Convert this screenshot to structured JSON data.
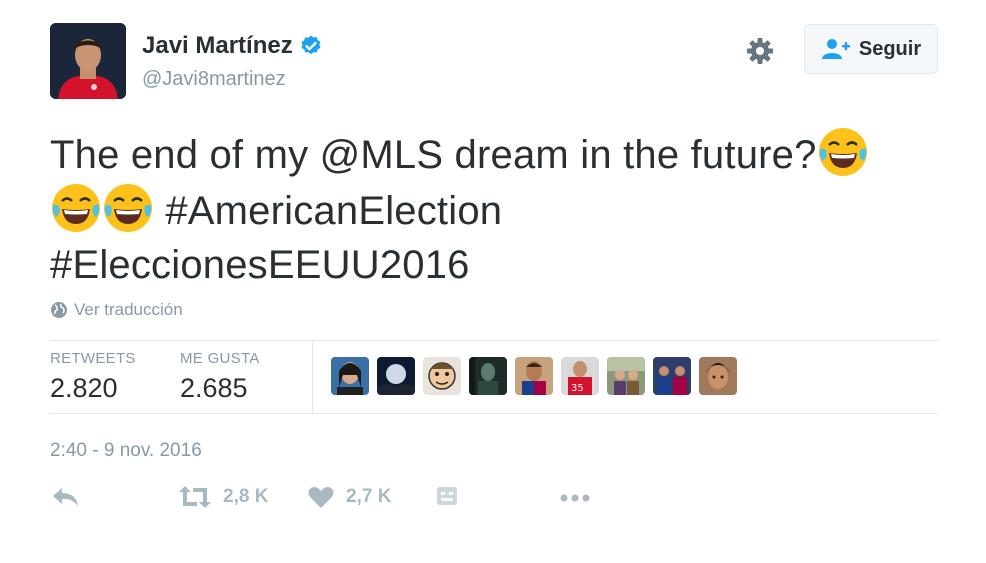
{
  "user": {
    "name": "Javi Martínez",
    "handle": "@Javi8martinez"
  },
  "follow_button": {
    "label": "Seguir"
  },
  "tweet": {
    "part1": "The end of my @MLS dream in the future?",
    "hashtag1": "#AmericanElection",
    "hashtag2": "#EleccionesEEUU2016"
  },
  "translate": {
    "label": "Ver traducción"
  },
  "stats": {
    "retweets_label": "RETWEETS",
    "retweets_value": "2.820",
    "likes_label": "ME GUSTA",
    "likes_value": "2.685"
  },
  "timestamp": "2:40 - 9 nov. 2016",
  "actions": {
    "retweet_count": "2,8 K",
    "like_count": "2,7 K"
  },
  "colors": {
    "text": "#292f33",
    "secondary": "#8899a6",
    "icons": "#aab8c2",
    "verified": "#1da1f2",
    "divider": "#e1e8ed"
  },
  "icons": [
    "verified-icon",
    "gear-icon",
    "follow-user-icon",
    "globe-icon",
    "reply-icon",
    "retweet-icon",
    "heart-icon",
    "gif-icon",
    "more-icon",
    "laughing-emoji"
  ]
}
